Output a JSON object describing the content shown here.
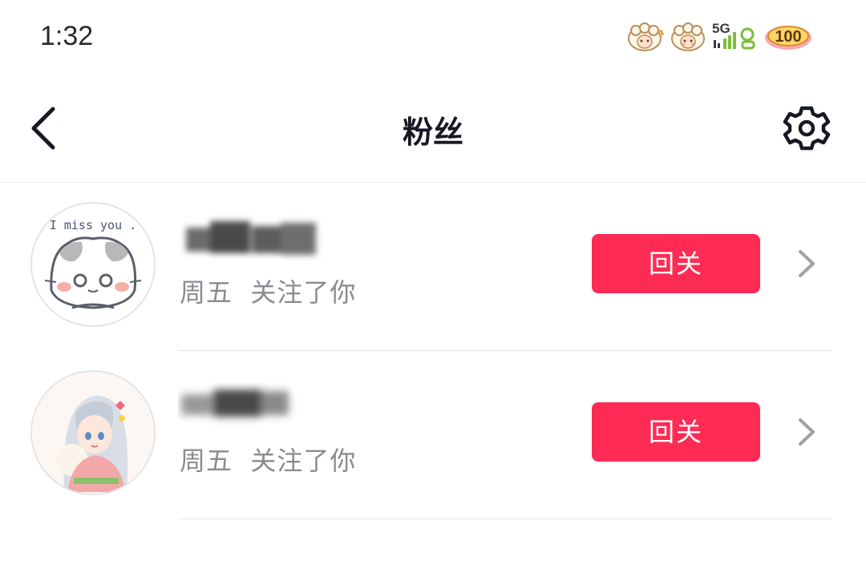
{
  "status_bar": {
    "time": "1:32",
    "network": "5G",
    "battery": "100",
    "icons": [
      "sheep-sticker-icon",
      "sheep-sticker-icon",
      "signal-5g-icon",
      "battery-icon"
    ]
  },
  "nav": {
    "title": "粉丝",
    "back_icon": "chevron-left-icon",
    "settings_icon": "gear-icon"
  },
  "followers": [
    {
      "name": "",
      "name_obscured": true,
      "avatar_text": "I miss you .",
      "avatar_icon": "cat-avatar",
      "follow_info": "周五  关注了你",
      "button_label": "回关"
    },
    {
      "name": "",
      "name_obscured": true,
      "avatar_icon": "anime-girl-avatar",
      "follow_info": "周五  关注了你",
      "button_label": "回关"
    }
  ],
  "colors": {
    "accent": "#fe2c55",
    "text_primary": "#161823",
    "text_secondary": "#8a8b91",
    "divider": "#e6e6e6"
  }
}
